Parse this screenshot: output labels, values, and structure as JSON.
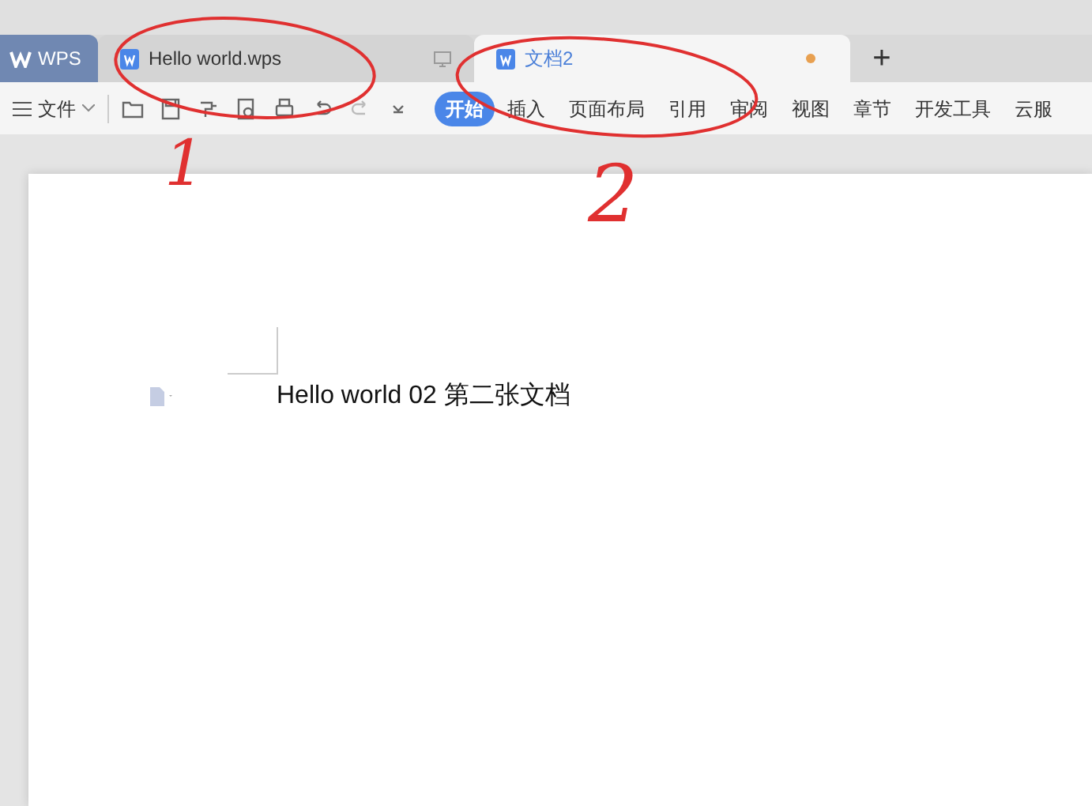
{
  "app_button": {
    "label": "WPS"
  },
  "tabs": [
    {
      "title": "Hello world.wps",
      "selected": false,
      "unsaved": false
    },
    {
      "title": "文档2",
      "selected": true,
      "unsaved": true
    }
  ],
  "new_tab": {
    "label": "+"
  },
  "file_menu": {
    "label": "文件"
  },
  "ribbon_tabs": [
    {
      "label": "开始",
      "selected": true
    },
    {
      "label": "插入",
      "selected": false
    },
    {
      "label": "页面布局",
      "selected": false
    },
    {
      "label": "引用",
      "selected": false
    },
    {
      "label": "审阅",
      "selected": false
    },
    {
      "label": "视图",
      "selected": false
    },
    {
      "label": "章节",
      "selected": false
    },
    {
      "label": "开发工具",
      "selected": false
    },
    {
      "label": "云服",
      "selected": false
    }
  ],
  "document": {
    "text": "Hello world 02 第二张文档"
  },
  "annotations": [
    {
      "label": "1"
    },
    {
      "label": "2"
    }
  ]
}
